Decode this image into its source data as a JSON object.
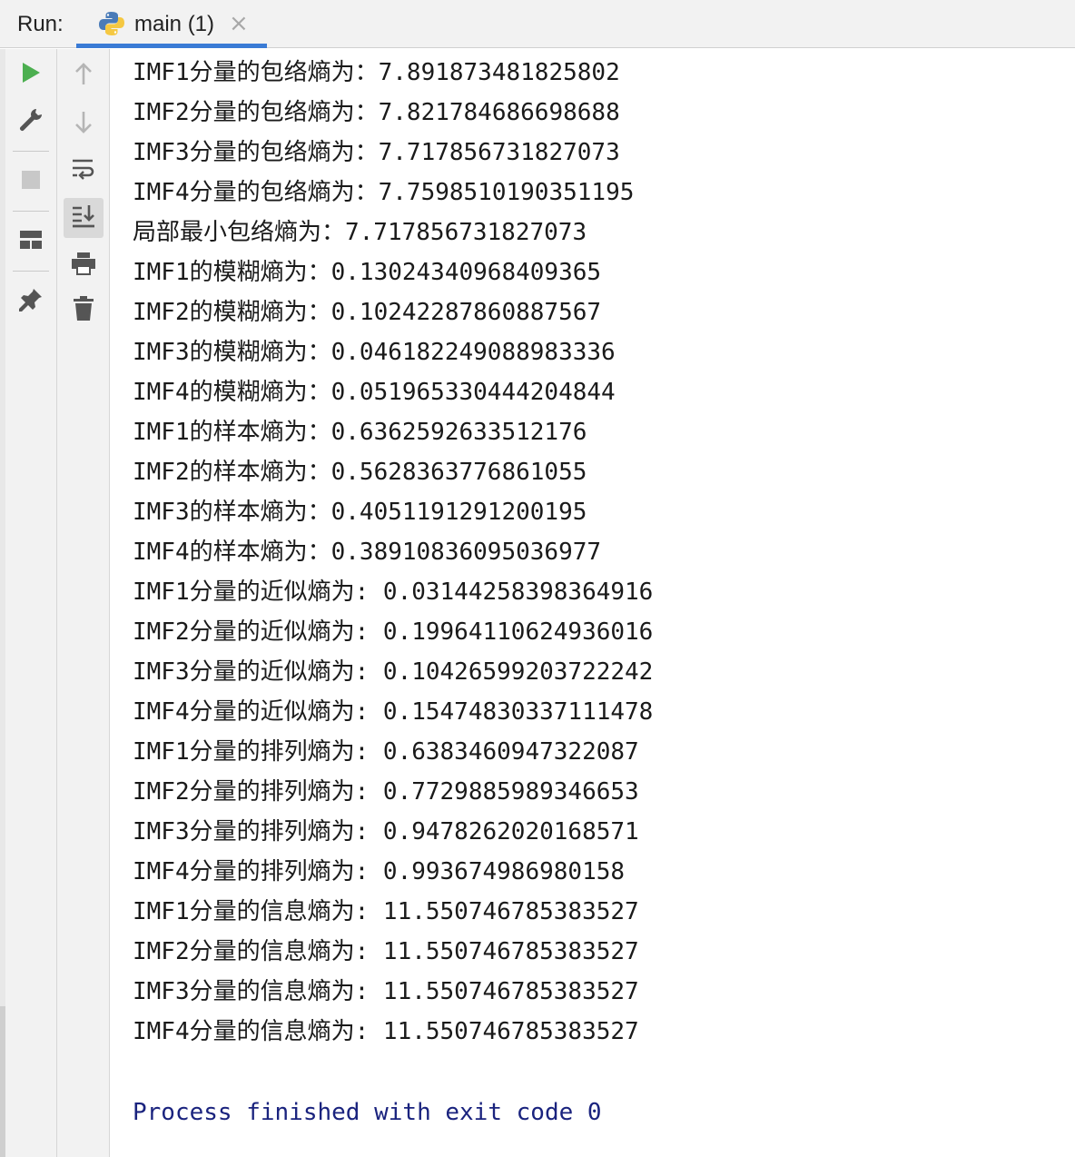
{
  "header": {
    "run_label": "Run:",
    "tab_label": "main (1)",
    "tab_close": "×"
  },
  "toolbar": {
    "left_buttons": [
      "run-icon",
      "wrench-icon",
      "stop-icon",
      "layout-icon",
      "pin-icon"
    ],
    "right_buttons": [
      "up-arrow-icon",
      "down-arrow-icon",
      "soft-wrap-icon",
      "scroll-to-end-icon",
      "print-icon",
      "trash-icon"
    ]
  },
  "console": {
    "lines": [
      "IMF1分量的包络熵为：7.891873481825802",
      "IMF2分量的包络熵为：7.821784686698688",
      "IMF3分量的包络熵为：7.717856731827073",
      "IMF4分量的包络熵为：7.7598510190351195",
      "局部最小包络熵为：7.717856731827073",
      "IMF1的模糊熵为：0.13024340968409365",
      "IMF2的模糊熵为：0.10242287860887567",
      "IMF3的模糊熵为：0.046182249088983336",
      "IMF4的模糊熵为：0.051965330444204844",
      "IMF1的样本熵为：0.6362592633512176",
      "IMF2的样本熵为：0.5628363776861055",
      "IMF3的样本熵为：0.4051191291200195",
      "IMF4的样本熵为：0.38910836095036977",
      "IMF1分量的近似熵为: 0.03144258398364916",
      "IMF2分量的近似熵为: 0.19964110624936016",
      "IMF3分量的近似熵为: 0.10426599203722242",
      "IMF4分量的近似熵为: 0.15474830337111478",
      "IMF1分量的排列熵为: 0.6383460947322087",
      "IMF2分量的排列熵为: 0.7729885989346653",
      "IMF3分量的排列熵为: 0.9478262020168571",
      "IMF4分量的排列熵为: 0.993674986980158",
      "IMF1分量的信息熵为: 11.550746785383527",
      "IMF2分量的信息熵为: 11.550746785383527",
      "IMF3分量的信息熵为: 11.550746785383527",
      "IMF4分量的信息熵为: 11.550746785383527"
    ],
    "finish_message": "Process finished with exit code 0"
  },
  "colors": {
    "run_green": "#4caf50",
    "tab_underline": "#3a7bd5",
    "finish_text": "#1a237e"
  }
}
